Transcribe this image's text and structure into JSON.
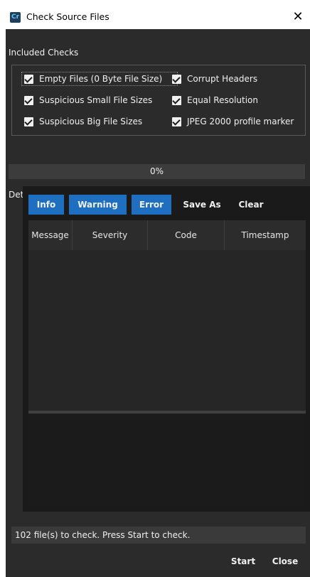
{
  "window": {
    "app_icon_text": "Cr",
    "title": "Check Source Files",
    "close_glyph": "✕"
  },
  "included_checks": {
    "label": "Included Checks",
    "items": [
      {
        "label": "Empty Files (0 Byte File Size)",
        "checked": true
      },
      {
        "label": "Corrupt Headers",
        "checked": true
      },
      {
        "label": "Suspicious Small File Sizes",
        "checked": true
      },
      {
        "label": "Equal Resolution",
        "checked": true
      },
      {
        "label": "Suspicious Big File Sizes",
        "checked": true
      },
      {
        "label": "JPEG 2000 profile marker",
        "checked": true
      }
    ]
  },
  "progress": {
    "text": "0%",
    "value_percent": 0
  },
  "detected_issues": {
    "label": "Detected Issues",
    "toolbar": {
      "info": "Info",
      "warning": "Warning",
      "error": "Error",
      "save_as": "Save As",
      "clear": "Clear"
    },
    "columns": [
      "Message",
      "Severity",
      "Code",
      "Timestamp"
    ]
  },
  "status": {
    "text": "102 file(s) to check. Press Start to check."
  },
  "buttons": {
    "start": "Start",
    "close": "Close"
  },
  "colors": {
    "background": "#2b2b2b",
    "accent": "#1f6fc1"
  }
}
